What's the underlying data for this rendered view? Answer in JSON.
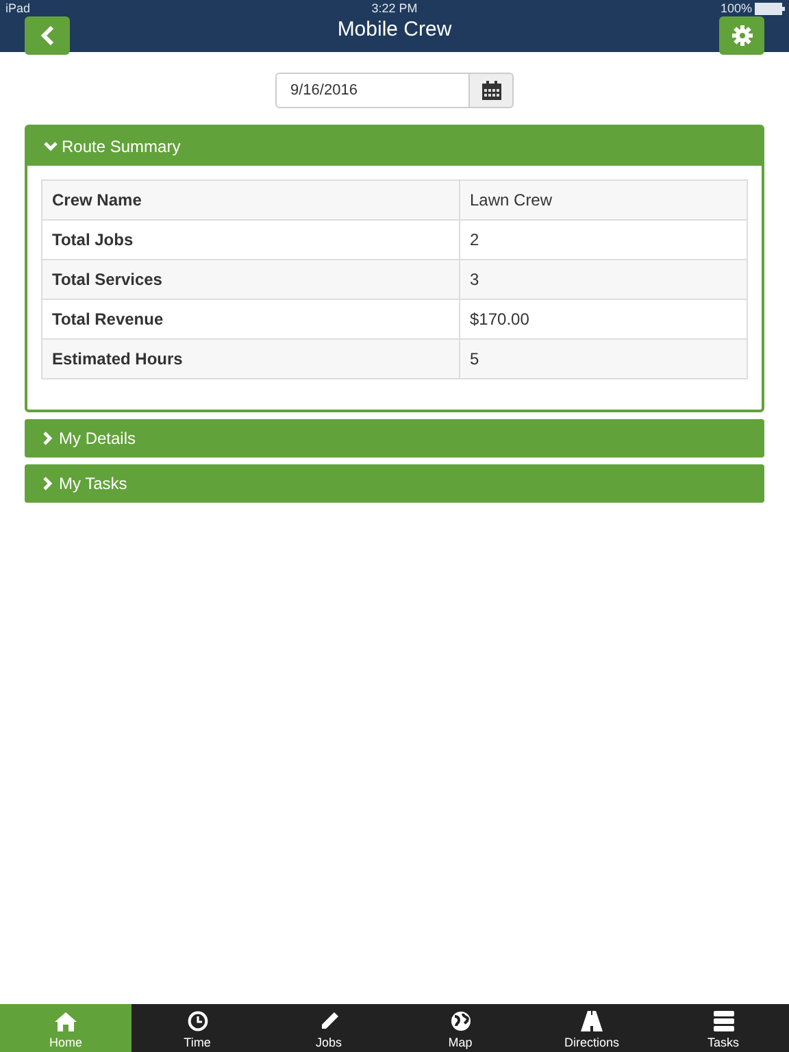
{
  "status_bar": {
    "device": "iPad",
    "time": "3:22 PM",
    "battery": "100%"
  },
  "header": {
    "title": "Mobile Crew"
  },
  "date_field": {
    "value": "9/16/2016"
  },
  "panels": [
    {
      "title": "Route Summary",
      "expanded": true,
      "rows": [
        {
          "label": "Crew Name",
          "value": "Lawn Crew"
        },
        {
          "label": "Total Jobs",
          "value": "2"
        },
        {
          "label": "Total Services",
          "value": "3"
        },
        {
          "label": "Total Revenue",
          "value": "$170.00"
        },
        {
          "label": "Estimated Hours",
          "value": "5"
        }
      ]
    },
    {
      "title": "My Details",
      "expanded": false
    },
    {
      "title": "My Tasks",
      "expanded": false
    }
  ],
  "tabs": [
    {
      "label": "Home",
      "kind": "home",
      "selected": true
    },
    {
      "label": "Time",
      "kind": "time",
      "selected": false
    },
    {
      "label": "Jobs",
      "kind": "jobs",
      "selected": false
    },
    {
      "label": "Map",
      "kind": "map",
      "selected": false
    },
    {
      "label": "Directions",
      "kind": "directions",
      "selected": false
    },
    {
      "label": "Tasks",
      "kind": "tasks",
      "selected": false
    }
  ]
}
